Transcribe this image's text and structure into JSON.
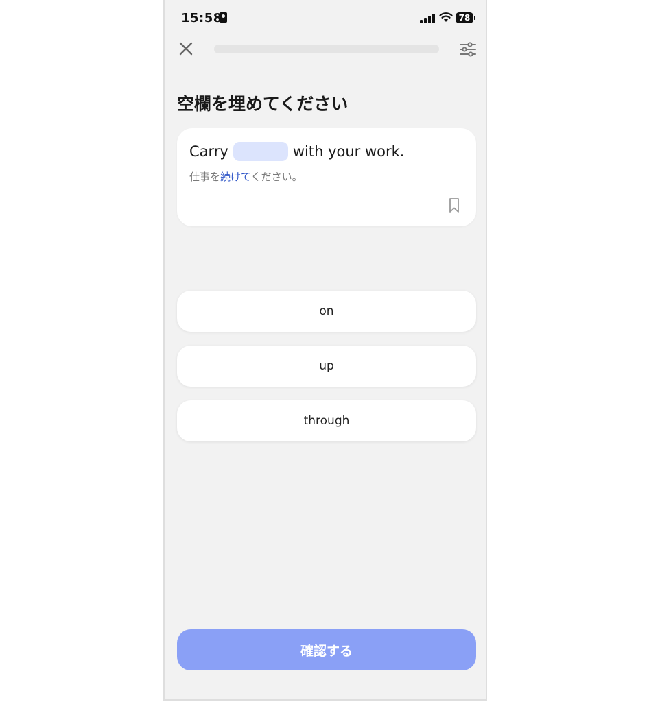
{
  "status_bar": {
    "time": "15:58",
    "battery": "78"
  },
  "header": {
    "progress": 0,
    "close_icon": "close-icon",
    "settings_icon": "sliders-icon"
  },
  "page": {
    "title": "空欄を埋めてください"
  },
  "question": {
    "sentence_before": "Carry",
    "sentence_after": "with your work.",
    "translation_before": "仕事を",
    "translation_highlight": "続けて",
    "translation_after": "ください。",
    "bookmark_icon": "bookmark-icon"
  },
  "options": [
    {
      "label": "on"
    },
    {
      "label": "up"
    },
    {
      "label": "through"
    }
  ],
  "confirm_label": "確認する",
  "colors": {
    "background": "#f2f2f2",
    "card": "#ffffff",
    "blank": "#dce4fd",
    "highlight": "#2e55c7",
    "confirm_button": "#8aa0f6"
  }
}
